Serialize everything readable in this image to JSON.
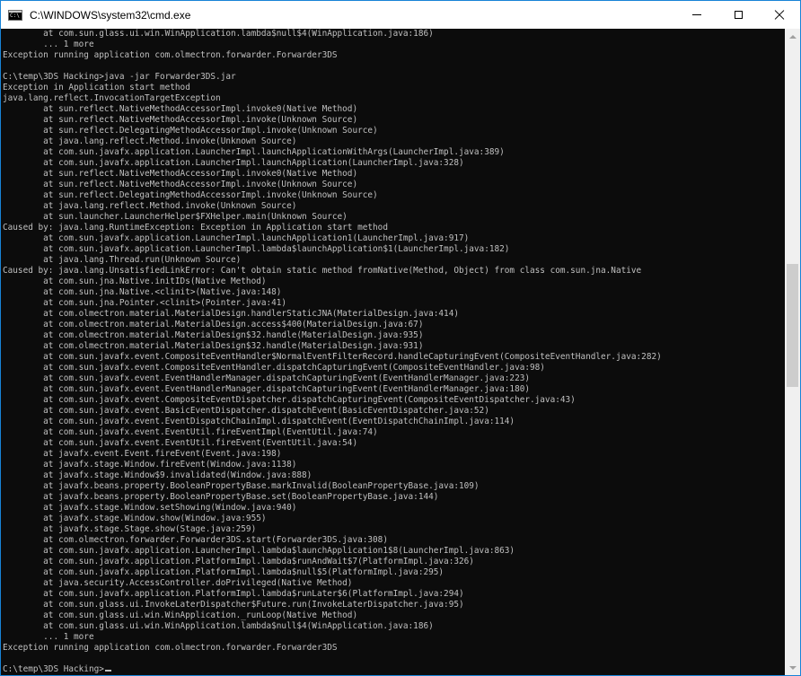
{
  "window": {
    "title": "C:\\WINDOWS\\system32\\cmd.exe",
    "icon": "cmd-icon",
    "controls": [
      "minimize-icon",
      "maximize-icon",
      "close-icon"
    ]
  },
  "colors": {
    "console_bg": "#0c0c0c",
    "console_text": "#c0c0c0",
    "border": "#1883d7"
  },
  "console": {
    "lines": [
      "        at com.sun.glass.ui.win.WinApplication.lambda$null$4(WinApplication.java:186)",
      "        ... 1 more",
      "Exception running application com.olmectron.forwarder.Forwarder3DS",
      "",
      "C:\\temp\\3DS Hacking>java -jar Forwarder3DS.jar",
      "Exception in Application start method",
      "java.lang.reflect.InvocationTargetException",
      "        at sun.reflect.NativeMethodAccessorImpl.invoke0(Native Method)",
      "        at sun.reflect.NativeMethodAccessorImpl.invoke(Unknown Source)",
      "        at sun.reflect.DelegatingMethodAccessorImpl.invoke(Unknown Source)",
      "        at java.lang.reflect.Method.invoke(Unknown Source)",
      "        at com.sun.javafx.application.LauncherImpl.launchApplicationWithArgs(LauncherImpl.java:389)",
      "        at com.sun.javafx.application.LauncherImpl.launchApplication(LauncherImpl.java:328)",
      "        at sun.reflect.NativeMethodAccessorImpl.invoke0(Native Method)",
      "        at sun.reflect.NativeMethodAccessorImpl.invoke(Unknown Source)",
      "        at sun.reflect.DelegatingMethodAccessorImpl.invoke(Unknown Source)",
      "        at java.lang.reflect.Method.invoke(Unknown Source)",
      "        at sun.launcher.LauncherHelper$FXHelper.main(Unknown Source)",
      "Caused by: java.lang.RuntimeException: Exception in Application start method",
      "        at com.sun.javafx.application.LauncherImpl.launchApplication1(LauncherImpl.java:917)",
      "        at com.sun.javafx.application.LauncherImpl.lambda$launchApplication$1(LauncherImpl.java:182)",
      "        at java.lang.Thread.run(Unknown Source)",
      "Caused by: java.lang.UnsatisfiedLinkError: Can't obtain static method fromNative(Method, Object) from class com.sun.jna.Native",
      "        at com.sun.jna.Native.initIDs(Native Method)",
      "        at com.sun.jna.Native.<clinit>(Native.java:148)",
      "        at com.sun.jna.Pointer.<clinit>(Pointer.java:41)",
      "        at com.olmectron.material.MaterialDesign.handlerStaticJNA(MaterialDesign.java:414)",
      "        at com.olmectron.material.MaterialDesign.access$400(MaterialDesign.java:67)",
      "        at com.olmectron.material.MaterialDesign$32.handle(MaterialDesign.java:935)",
      "        at com.olmectron.material.MaterialDesign$32.handle(MaterialDesign.java:931)",
      "        at com.sun.javafx.event.CompositeEventHandler$NormalEventFilterRecord.handleCapturingEvent(CompositeEventHandler.java:282)",
      "        at com.sun.javafx.event.CompositeEventHandler.dispatchCapturingEvent(CompositeEventHandler.java:98)",
      "        at com.sun.javafx.event.EventHandlerManager.dispatchCapturingEvent(EventHandlerManager.java:223)",
      "        at com.sun.javafx.event.EventHandlerManager.dispatchCapturingEvent(EventHandlerManager.java:180)",
      "        at com.sun.javafx.event.CompositeEventDispatcher.dispatchCapturingEvent(CompositeEventDispatcher.java:43)",
      "        at com.sun.javafx.event.BasicEventDispatcher.dispatchEvent(BasicEventDispatcher.java:52)",
      "        at com.sun.javafx.event.EventDispatchChainImpl.dispatchEvent(EventDispatchChainImpl.java:114)",
      "        at com.sun.javafx.event.EventUtil.fireEventImpl(EventUtil.java:74)",
      "        at com.sun.javafx.event.EventUtil.fireEvent(EventUtil.java:54)",
      "        at javafx.event.Event.fireEvent(Event.java:198)",
      "        at javafx.stage.Window.fireEvent(Window.java:1138)",
      "        at javafx.stage.Window$9.invalidated(Window.java:888)",
      "        at javafx.beans.property.BooleanPropertyBase.markInvalid(BooleanPropertyBase.java:109)",
      "        at javafx.beans.property.BooleanPropertyBase.set(BooleanPropertyBase.java:144)",
      "        at javafx.stage.Window.setShowing(Window.java:940)",
      "        at javafx.stage.Window.show(Window.java:955)",
      "        at javafx.stage.Stage.show(Stage.java:259)",
      "        at com.olmectron.forwarder.Forwarder3DS.start(Forwarder3DS.java:308)",
      "        at com.sun.javafx.application.LauncherImpl.lambda$launchApplication1$8(LauncherImpl.java:863)",
      "        at com.sun.javafx.application.PlatformImpl.lambda$runAndWait$7(PlatformImpl.java:326)",
      "        at com.sun.javafx.application.PlatformImpl.lambda$null$5(PlatformImpl.java:295)",
      "        at java.security.AccessController.doPrivileged(Native Method)",
      "        at com.sun.javafx.application.PlatformImpl.lambda$runLater$6(PlatformImpl.java:294)",
      "        at com.sun.glass.ui.InvokeLaterDispatcher$Future.run(InvokeLaterDispatcher.java:95)",
      "        at com.sun.glass.ui.win.WinApplication._runLoop(Native Method)",
      "        at com.sun.glass.ui.win.WinApplication.lambda$null$4(WinApplication.java:186)",
      "        ... 1 more",
      "Exception running application com.olmectron.forwarder.Forwarder3DS",
      ""
    ],
    "prompt": "C:\\temp\\3DS Hacking>"
  },
  "scrollbar": {
    "up": "scroll-up-icon",
    "down": "scroll-down-icon"
  }
}
